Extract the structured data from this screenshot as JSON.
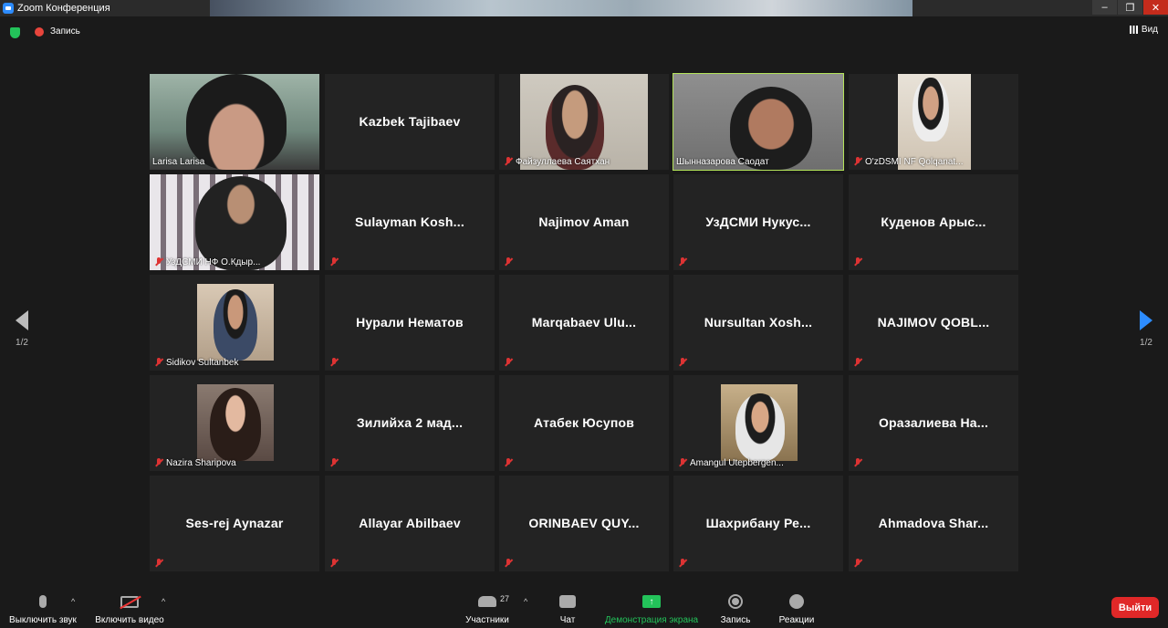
{
  "window": {
    "title": "Zoom Конференция"
  },
  "topbar": {
    "recording_label": "Запись",
    "view_label": "Вид"
  },
  "pager": {
    "left_label": "1/2",
    "right_label": "1/2"
  },
  "participants": [
    {
      "name": "Larisa Larisa",
      "video": true
    },
    {
      "name": "Kazbek Tajibaev",
      "video": false,
      "no_mic_icon": true
    },
    {
      "name": "Файзуллаева Саятхан",
      "video": true
    },
    {
      "name": "Шынназарова Саодат",
      "video": true,
      "active": true
    },
    {
      "name": "O'zDSMI NF Qolqanat...",
      "video": true
    },
    {
      "name": "УзДСМИ НФ О.Кдыр...",
      "video": true
    },
    {
      "name": "Sulayman  Kosh...",
      "video": false
    },
    {
      "name": "Najimov Aman",
      "video": false
    },
    {
      "name": "УзДСМИ  Нукус...",
      "video": false
    },
    {
      "name": "Куденов  Арыс...",
      "video": false
    },
    {
      "name": "Sidikov Sultanbek",
      "video": true
    },
    {
      "name": "Нурали Нематов",
      "video": false
    },
    {
      "name": "Marqabaev  Ulu...",
      "video": false
    },
    {
      "name": "Nursultan  Xosh...",
      "video": false
    },
    {
      "name": "NAJIMOV  QOBL...",
      "video": false
    },
    {
      "name": "Nazira Sharipova",
      "video": true
    },
    {
      "name": "Зилийха 2 мад...",
      "video": false
    },
    {
      "name": "Атабек Юсупов",
      "video": false
    },
    {
      "name": "Amangul Utepbergen...",
      "video": true
    },
    {
      "name": "Оразалиева  На...",
      "video": false
    },
    {
      "name": "Ses-rej Aynazar",
      "video": false
    },
    {
      "name": "Allayar Abilbaev",
      "video": false
    },
    {
      "name": "ORINBAEV  QUY...",
      "video": false
    },
    {
      "name": "Шахрибану  Ре...",
      "video": false
    },
    {
      "name": "Ahmadova  Shar...",
      "video": false
    }
  ],
  "toolbar": {
    "mute_label": "Выключить звук",
    "video_label": "Включить видео",
    "participants_label": "Участники",
    "participants_count": "27",
    "chat_label": "Чат",
    "share_label": "Демонстрация экрана",
    "record_label": "Запись",
    "reactions_label": "Реакции",
    "leave_label": "Выйти"
  },
  "colors": {
    "accent": "#2d8cff",
    "share_green": "#23c35a",
    "active_speaker": "#b4e35a",
    "leave_red": "#e02828"
  }
}
